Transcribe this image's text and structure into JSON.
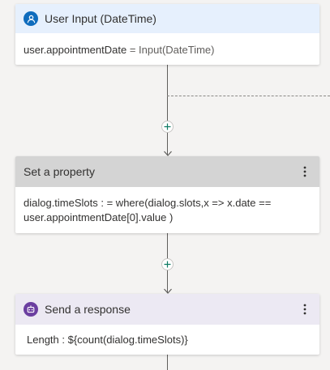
{
  "colors": {
    "canvas_bg": "#f4f3f2",
    "input_header_bg": "#e6f0fd",
    "input_icon_bg": "#0f6cbd",
    "property_header_bg": "#d4d4d4",
    "response_header_bg": "#ece9f3",
    "response_icon_bg": "#6b3fa0",
    "add_icon": "#0f7b64"
  },
  "cards": {
    "user_input": {
      "title": "User Input (DateTime)",
      "icon": "user-icon",
      "body_property": "user.appointmentDate",
      "body_equals": "=",
      "body_value": "Input(DateTime)"
    },
    "set_property": {
      "title": "Set a property",
      "icon": "more-vertical-icon",
      "body_line1": "dialog.timeSlots : = where(dialog.slots,x => x.date ==",
      "body_line2": "user.appointmentDate[0].value )"
    },
    "send_response": {
      "title": "Send a response",
      "icon": "bot-icon",
      "body": "Length : ${count(dialog.timeSlots)}"
    }
  },
  "connectors": {
    "add_icon": "plus-icon",
    "arrow_icon": "arrow-down-icon"
  }
}
